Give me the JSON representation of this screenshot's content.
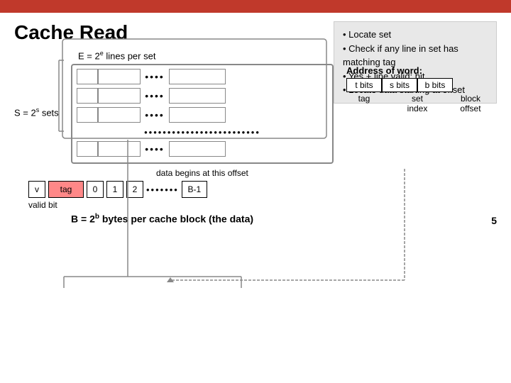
{
  "topbar": {
    "color": "#c0392b"
  },
  "title": "Cache Read",
  "info_box": {
    "items": [
      "Locate set",
      "Check if any line in set has matching tag",
      "Yes + line valid: hit",
      "Locate data starting at offset"
    ]
  },
  "e_label": "E = 2",
  "e_sup": "e",
  "e_suffix": " lines per set",
  "s_label": "S = 2",
  "s_sup": "s",
  "s_suffix": " sets",
  "address_word_title": "Address of word:",
  "bits": {
    "t_label": "t bits",
    "s_label": "s bits",
    "b_label": "b bits"
  },
  "word_labels": {
    "tag": "tag",
    "set_index": "set",
    "block_offset": "block",
    "index_label": "index",
    "offset_label": "offset"
  },
  "data_begins_label": "data begins at this offset",
  "cache_line": {
    "v": "v",
    "tag": "tag",
    "num0": "0",
    "num1": "1",
    "num2": "2",
    "b_minus_1": "B-1"
  },
  "valid_bit_label": "valid bit",
  "b_label": "B = 2",
  "b_sup": "b",
  "b_suffix": " bytes per cache block (the data)",
  "page_number": "5",
  "dots": "••••",
  "row_dots": "•••••••••••••••••••••••••"
}
